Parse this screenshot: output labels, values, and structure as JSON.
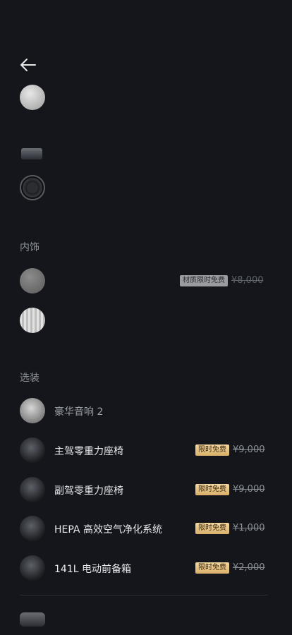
{
  "sections": {
    "interior": "内饰",
    "options": "选装"
  },
  "interior_item": {
    "badge": "材质限时免费",
    "price": "¥8,000"
  },
  "options": [
    {
      "label": "豪华音响 2",
      "badge": "",
      "price": ""
    },
    {
      "label": "主驾零重力座椅",
      "badge": "限时免费",
      "price": "¥9,000"
    },
    {
      "label": "副驾零重力座椅",
      "badge": "限时免费",
      "price": "¥9,000"
    },
    {
      "label": "HEPA 高效空气净化系统",
      "badge": "限时免费",
      "price": "¥1,000"
    },
    {
      "label": "141L 电动前备箱",
      "badge": "限时免费",
      "price": "¥2,000"
    }
  ],
  "icons": {
    "back": "arrow-left-icon"
  },
  "colors": {
    "background": "#14161b",
    "badge_gold": "#e6c385",
    "badge_gray": "#9a9ca0"
  }
}
